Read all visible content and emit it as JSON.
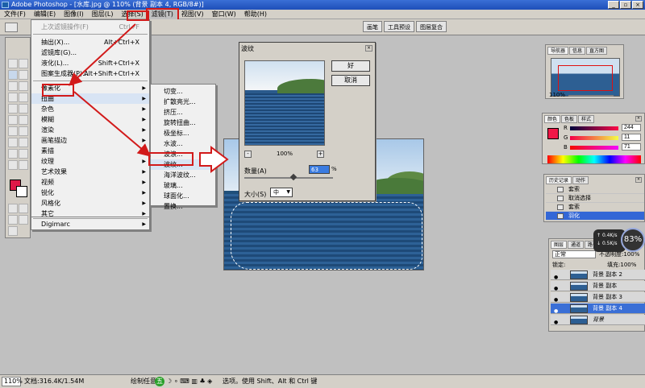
{
  "window": {
    "title": "Adobe Photoshop - [水库.jpg @ 110% (背景 副本 4, RGB/8#)]"
  },
  "window_controls": {
    "minimize": "_",
    "restore": "▫",
    "close": "×"
  },
  "menubar": [
    "文件(F)",
    "编辑(E)",
    "图像(I)",
    "图层(L)",
    "选择(S)",
    "滤镜(T)",
    "视图(V)",
    "窗口(W)",
    "帮助(H)"
  ],
  "palette_well": [
    "画笔",
    "工具预设",
    "图层复合"
  ],
  "filter_menu": {
    "last_filter": {
      "label": "上次滤镜操作(F)",
      "shortcut": "Ctrl+F"
    },
    "group1": [
      {
        "label": "抽出(X)...",
        "shortcut": "Alt+Ctrl+X"
      },
      {
        "label": "滤镜库(G)...",
        "shortcut": ""
      },
      {
        "label": "液化(L)...",
        "shortcut": "Shift+Ctrl+X"
      },
      {
        "label": "图案生成器(P)...",
        "shortcut": "Alt+Shift+Ctrl+X"
      }
    ],
    "group2": [
      "像素化",
      "扭曲",
      "杂色",
      "模糊",
      "渲染",
      "画笔描边",
      "素描",
      "纹理",
      "艺术效果",
      "视频",
      "锐化",
      "风格化",
      "其它"
    ],
    "group3": [
      "Digimarc"
    ]
  },
  "distort_submenu": [
    "切变...",
    "扩散亮光...",
    "挤压...",
    "旋转扭曲...",
    "极坐标...",
    "水波...",
    "波浪...",
    "波纹...",
    "海洋波纹...",
    "玻璃...",
    "球面化...",
    "置换..."
  ],
  "ripple_dialog": {
    "title": "波纹",
    "ok_label": "好",
    "cancel_label": "取消",
    "zoom_minus": "-",
    "zoom_plus": "+",
    "zoom": "100%",
    "amount_label": "数量(A)",
    "amount_value": "63",
    "amount_unit": "%",
    "amount_slider_fraction": 0.55,
    "size_label": "大小(S)",
    "size_value": "中"
  },
  "navigator": {
    "tabs": [
      "导航器",
      "信息",
      "直方图"
    ],
    "zoom": "110%"
  },
  "color_panel": {
    "tabs": [
      "颜色",
      "色板",
      "样式"
    ],
    "foreground_hex": "#f40b47",
    "channels": [
      {
        "label": "R",
        "value": "244"
      },
      {
        "label": "G",
        "value": "11"
      },
      {
        "label": "B",
        "value": "71"
      }
    ]
  },
  "history_panel": {
    "tabs": [
      "历史记录",
      "动作"
    ],
    "items": [
      {
        "label": "套索",
        "selected": false
      },
      {
        "label": "取消选择",
        "selected": false
      },
      {
        "label": "套索",
        "selected": false
      },
      {
        "label": "羽化",
        "selected": true
      }
    ]
  },
  "layers_panel": {
    "tabs": [
      "图层",
      "通道",
      "路径"
    ],
    "blend_mode": "正常",
    "opacity_label": "不透明度:",
    "opacity_value": "100%",
    "lock_label": "锁定:",
    "fill_label": "填充:",
    "fill_value": "100%",
    "layers": [
      {
        "name": "背景 副本 2",
        "selected": false
      },
      {
        "name": "背景 副本",
        "selected": false
      },
      {
        "name": "背景 副本 3",
        "selected": false
      },
      {
        "name": "背景 副本 4",
        "selected": true
      },
      {
        "name": "背景",
        "selected": false
      }
    ]
  },
  "gauge": {
    "percent": "83%",
    "up": "0.4K/s",
    "down": "0.5K/s"
  },
  "statusbar": {
    "zoom": "110%",
    "doc": "文档:316.4K/1.54M",
    "hint_prefix": "绘制任意",
    "ime": "五",
    "hint": "选项。使用 Shift、Alt 和 Ctrl 键"
  },
  "colors": {
    "foreground": "#e01848",
    "background": "#ffffff",
    "highlight": "#d21a1a",
    "selection": "#3a6fd6"
  }
}
